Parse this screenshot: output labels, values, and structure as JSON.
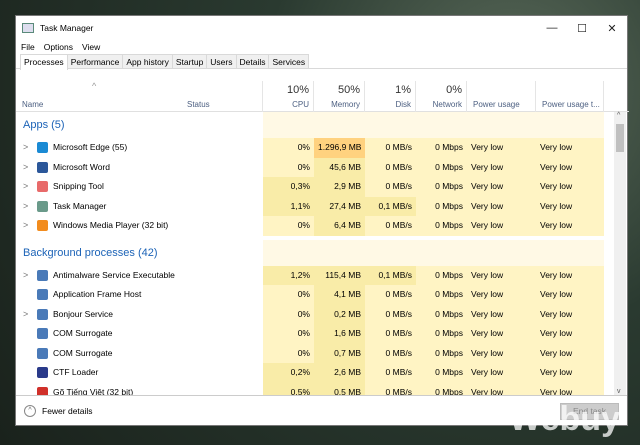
{
  "window": {
    "title": "Task Manager",
    "minimize": "—",
    "maximize": "☐",
    "close": "✕"
  },
  "menu": [
    "File",
    "Options",
    "View"
  ],
  "tabs": [
    "Processes",
    "Performance",
    "App history",
    "Startup",
    "Users",
    "Details",
    "Services"
  ],
  "columns": [
    {
      "label": "Name",
      "pct": ""
    },
    {
      "label": "Status",
      "pct": ""
    },
    {
      "label": "CPU",
      "pct": "10%"
    },
    {
      "label": "Memory",
      "pct": "50%"
    },
    {
      "label": "Disk",
      "pct": "1%"
    },
    {
      "label": "Network",
      "pct": "0%"
    },
    {
      "label": "Power usage",
      "pct": ""
    },
    {
      "label": "Power usage t...",
      "pct": ""
    }
  ],
  "groups": [
    {
      "title": "Apps (5)",
      "rows": [
        {
          "name": "Microsoft Edge (55)",
          "expand": true,
          "icon": "edge-icon",
          "color": "#1a8ad4",
          "cpu": "0%",
          "mem": "1.296,9 MB",
          "disk": "0 MB/s",
          "net": "0 Mbps",
          "power": "Very low",
          "trend": "Very low",
          "heat": [
            0,
            3,
            0,
            0
          ]
        },
        {
          "name": "Microsoft Word",
          "expand": true,
          "icon": "word-icon",
          "color": "#2b579a",
          "cpu": "0%",
          "mem": "45,6 MB",
          "disk": "0 MB/s",
          "net": "0 Mbps",
          "power": "Very low",
          "trend": "Very low",
          "heat": [
            0,
            1,
            0,
            0
          ]
        },
        {
          "name": "Snipping Tool",
          "expand": true,
          "icon": "snipping-tool-icon",
          "color": "#e86a6a",
          "cpu": "0,3%",
          "mem": "2,9 MB",
          "disk": "0 MB/s",
          "net": "0 Mbps",
          "power": "Very low",
          "trend": "Very low",
          "heat": [
            1,
            1,
            0,
            0
          ]
        },
        {
          "name": "Task Manager",
          "expand": true,
          "icon": "task-manager-icon",
          "color": "#6a9a8a",
          "cpu": "1,1%",
          "mem": "27,4 MB",
          "disk": "0,1 MB/s",
          "net": "0 Mbps",
          "power": "Very low",
          "trend": "Very low",
          "heat": [
            1,
            1,
            1,
            0
          ]
        },
        {
          "name": "Windows Media Player (32 bit)",
          "expand": true,
          "icon": "media-player-icon",
          "color": "#f28c1e",
          "cpu": "0%",
          "mem": "6,4 MB",
          "disk": "0 MB/s",
          "net": "0 Mbps",
          "power": "Very low",
          "trend": "Very low",
          "heat": [
            0,
            1,
            0,
            0
          ]
        }
      ]
    },
    {
      "title": "Background processes (42)",
      "rows": [
        {
          "name": "Antimalware Service Executable",
          "expand": true,
          "icon": "service-icon",
          "color": "#4a7ab8",
          "cpu": "1,2%",
          "mem": "115,4 MB",
          "disk": "0,1 MB/s",
          "net": "0 Mbps",
          "power": "Very low",
          "trend": "Very low",
          "heat": [
            1,
            1,
            1,
            0
          ]
        },
        {
          "name": "Application Frame Host",
          "expand": false,
          "icon": "service-icon",
          "color": "#4a7ab8",
          "cpu": "0%",
          "mem": "4,1 MB",
          "disk": "0 MB/s",
          "net": "0 Mbps",
          "power": "Very low",
          "trend": "Very low",
          "heat": [
            0,
            1,
            0,
            0
          ]
        },
        {
          "name": "Bonjour Service",
          "expand": true,
          "icon": "service-icon",
          "color": "#4a7ab8",
          "cpu": "0%",
          "mem": "0,2 MB",
          "disk": "0 MB/s",
          "net": "0 Mbps",
          "power": "Very low",
          "trend": "Very low",
          "heat": [
            0,
            1,
            0,
            0
          ]
        },
        {
          "name": "COM Surrogate",
          "expand": false,
          "icon": "service-icon",
          "color": "#4a7ab8",
          "cpu": "0%",
          "mem": "1,6 MB",
          "disk": "0 MB/s",
          "net": "0 Mbps",
          "power": "Very low",
          "trend": "Very low",
          "heat": [
            0,
            1,
            0,
            0
          ]
        },
        {
          "name": "COM Surrogate",
          "expand": false,
          "icon": "service-icon",
          "color": "#4a7ab8",
          "cpu": "0%",
          "mem": "0,7 MB",
          "disk": "0 MB/s",
          "net": "0 Mbps",
          "power": "Very low",
          "trend": "Very low",
          "heat": [
            0,
            1,
            0,
            0
          ]
        },
        {
          "name": "CTF Loader",
          "expand": false,
          "icon": "ctf-loader-icon",
          "color": "#2a3a8a",
          "cpu": "0,2%",
          "mem": "2,6 MB",
          "disk": "0 MB/s",
          "net": "0 Mbps",
          "power": "Very low",
          "trend": "Very low",
          "heat": [
            1,
            1,
            0,
            0
          ]
        },
        {
          "name": "Gõ Tiếng Việt (32 bit)",
          "expand": false,
          "icon": "vietnamese-input-icon",
          "color": "#d0302a",
          "cpu": "0,5%",
          "mem": "0,5 MB",
          "disk": "0 MB/s",
          "net": "0 Mbps",
          "power": "Very low",
          "trend": "Very low",
          "heat": [
            1,
            1,
            0,
            0
          ]
        }
      ]
    }
  ],
  "footer": {
    "fewer_details": "Fewer details",
    "end_task": "End task"
  },
  "watermark": "Webuy",
  "colors": {
    "heat0": "#fff4c4",
    "heat1": "#f9eca8",
    "heat3": "#ffd27f",
    "group": "#fff9e5",
    "accent": "#1c63b7"
  }
}
